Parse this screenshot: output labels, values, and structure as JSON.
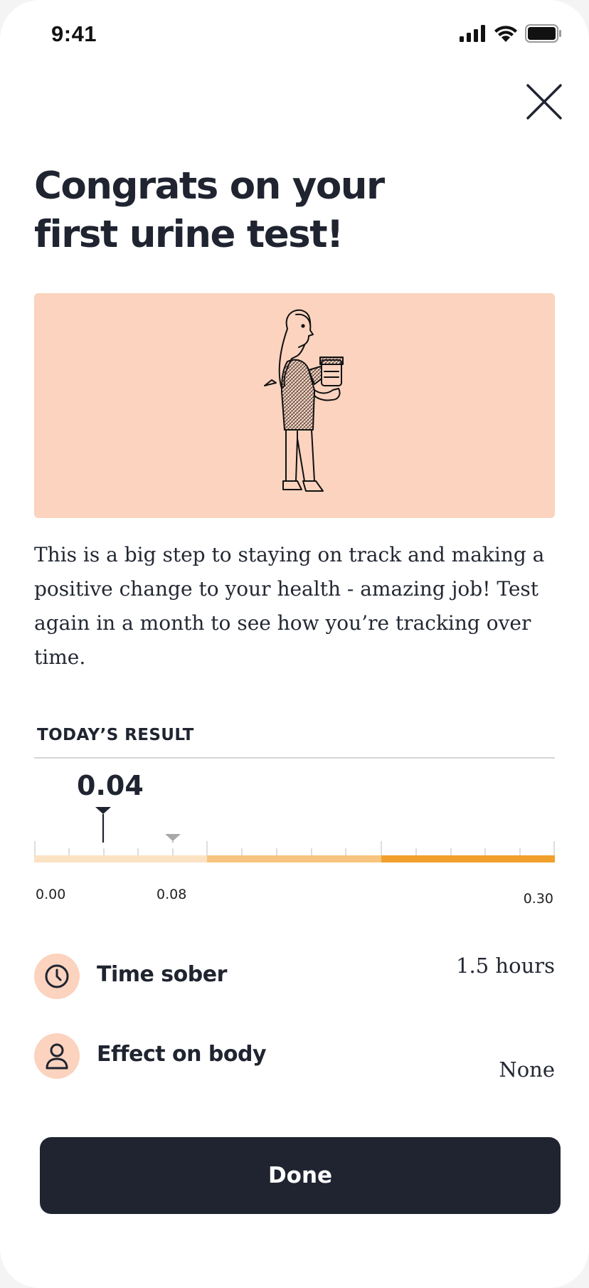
{
  "status_bar": {
    "time": "9:41",
    "icons": [
      "signal-icon",
      "wifi-icon",
      "battery-icon"
    ]
  },
  "header": {
    "close_icon": "close-icon"
  },
  "title": {
    "line1": "Congrats on your",
    "line2": "first urine test!"
  },
  "hero": {
    "illustration": "person-holding-sample-cup",
    "background": "#fbd3be"
  },
  "body_text": "This is a big step to staying on track and making a positive change to your health - amazing job! Test again in a month to see how you’re tracking over time.",
  "result": {
    "section_label": "TODAY’S RESULT",
    "value": "0.04",
    "value_number": 0.04,
    "reference_marker": 0.08,
    "scale_min_label": "0.00",
    "scale_mid_label": "0.08",
    "scale_max_label": "0.30",
    "segment_colors": [
      "#fae2c2",
      "#f7c57f",
      "#f0a02b"
    ]
  },
  "stats": [
    {
      "icon": "clock-icon",
      "label": "Time sober",
      "value": "1.5 hours"
    },
    {
      "icon": "person-icon",
      "label": "Effect on body",
      "value": "None"
    }
  ],
  "done_button": {
    "label": "Done"
  },
  "colors": {
    "accent": "#fbd3be",
    "dark": "#1f2430"
  }
}
